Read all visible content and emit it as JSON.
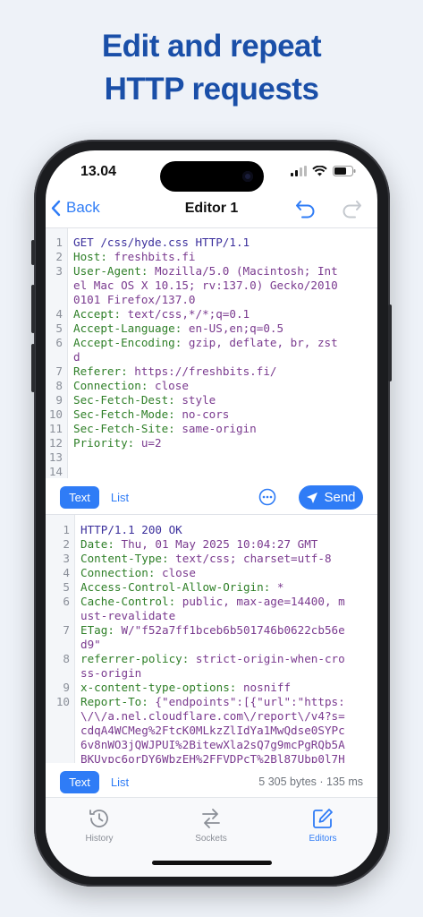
{
  "headline": {
    "line1": "Edit and repeat",
    "line2": "HTTP requests"
  },
  "status": {
    "time": "13.04"
  },
  "nav": {
    "back_label": "Back",
    "title": "Editor 1"
  },
  "request": {
    "lines": [
      {
        "n": "1",
        "t": "GET /css/hyde.css HTTP/1.1"
      },
      {
        "n": "2",
        "k": "Host:",
        "v": " freshbits.fi"
      },
      {
        "n": "3",
        "k": "User-Agent:",
        "v": " Mozilla/5.0 (Macintosh; Int"
      },
      {
        "n": "",
        "v": "el Mac OS X 10.15; rv:137.0) Gecko/2010"
      },
      {
        "n": "",
        "v": "0101 Firefox/137.0"
      },
      {
        "n": "4",
        "k": "Accept:",
        "v": " text/css,*/*;q=0.1"
      },
      {
        "n": "5",
        "k": "Accept-Language:",
        "v": " en-US,en;q=0.5"
      },
      {
        "n": "6",
        "k": "Accept-Encoding:",
        "v": " gzip, deflate, br, zst"
      },
      {
        "n": "",
        "v": "d"
      },
      {
        "n": "7",
        "k": "Referer:",
        "v": " https://freshbits.fi/"
      },
      {
        "n": "8",
        "k": "Connection:",
        "v": " close"
      },
      {
        "n": "9",
        "k": "Sec-Fetch-Dest:",
        "v": " style"
      },
      {
        "n": "10",
        "k": "Sec-Fetch-Mode:",
        "v": " no-cors"
      },
      {
        "n": "11",
        "k": "Sec-Fetch-Site:",
        "v": " same-origin"
      },
      {
        "n": "12",
        "k": "Priority:",
        "v": " u=2"
      },
      {
        "n": "13",
        "t": ""
      },
      {
        "n": "14",
        "t": ""
      }
    ]
  },
  "request_toolbar": {
    "text_label": "Text",
    "list_label": "List",
    "send_label": "Send"
  },
  "response": {
    "lines": [
      {
        "n": "1",
        "t": "HTTP/1.1 200 OK"
      },
      {
        "n": "2",
        "k": "Date:",
        "v": " Thu, 01 May 2025 10:04:27 GMT"
      },
      {
        "n": "3",
        "k": "Content-Type:",
        "v": " text/css; charset=utf-8"
      },
      {
        "n": "4",
        "k": "Connection:",
        "v": " close"
      },
      {
        "n": "5",
        "k": "Access-Control-Allow-Origin:",
        "v": " *"
      },
      {
        "n": "6",
        "k": "Cache-Control:",
        "v": " public, max-age=14400, m"
      },
      {
        "n": "",
        "v": "ust-revalidate"
      },
      {
        "n": "7",
        "k": "ETag:",
        "v": " W/\"f52a7ff1bceb6b501746b0622cb56e"
      },
      {
        "n": "",
        "v": "d9\""
      },
      {
        "n": "8",
        "k": "referrer-policy:",
        "v": " strict-origin-when-cro"
      },
      {
        "n": "",
        "v": "ss-origin"
      },
      {
        "n": "9",
        "k": "x-content-type-options:",
        "v": " nosniff"
      },
      {
        "n": "10",
        "k": "Report-To:",
        "v": " {\"endpoints\":[{\"url\":\"https:"
      },
      {
        "n": "",
        "v": "\\/\\/a.nel.cloudflare.com\\/report\\/v4?s="
      },
      {
        "n": "",
        "v": "cdqA4WCMeg%2FtcK0MLkzZlIdYa1MwQdse0SYPc"
      },
      {
        "n": "",
        "v": "6v8nWO3jQWJPUI%2BitewXla2sQ7g9mcPgRQb5A"
      },
      {
        "n": "",
        "v": "BKUvpc6orDY6WbzEH%2FFVDPcT%2Bl87Ubp0l7H"
      }
    ]
  },
  "response_toolbar": {
    "text_label": "Text",
    "list_label": "List",
    "meta": "5 305 bytes · 135 ms"
  },
  "tabs": [
    {
      "label": "History",
      "icon": "clock-icon"
    },
    {
      "label": "Sockets",
      "icon": "arrows-icon"
    },
    {
      "label": "Editors",
      "icon": "edit-icon"
    }
  ],
  "colors": {
    "accent": "#2f7cf6",
    "headline": "#1a4fa8",
    "code_key": "#2e7f27",
    "code_value": "#7a3a8f",
    "code_plain": "#3b2f9c"
  }
}
